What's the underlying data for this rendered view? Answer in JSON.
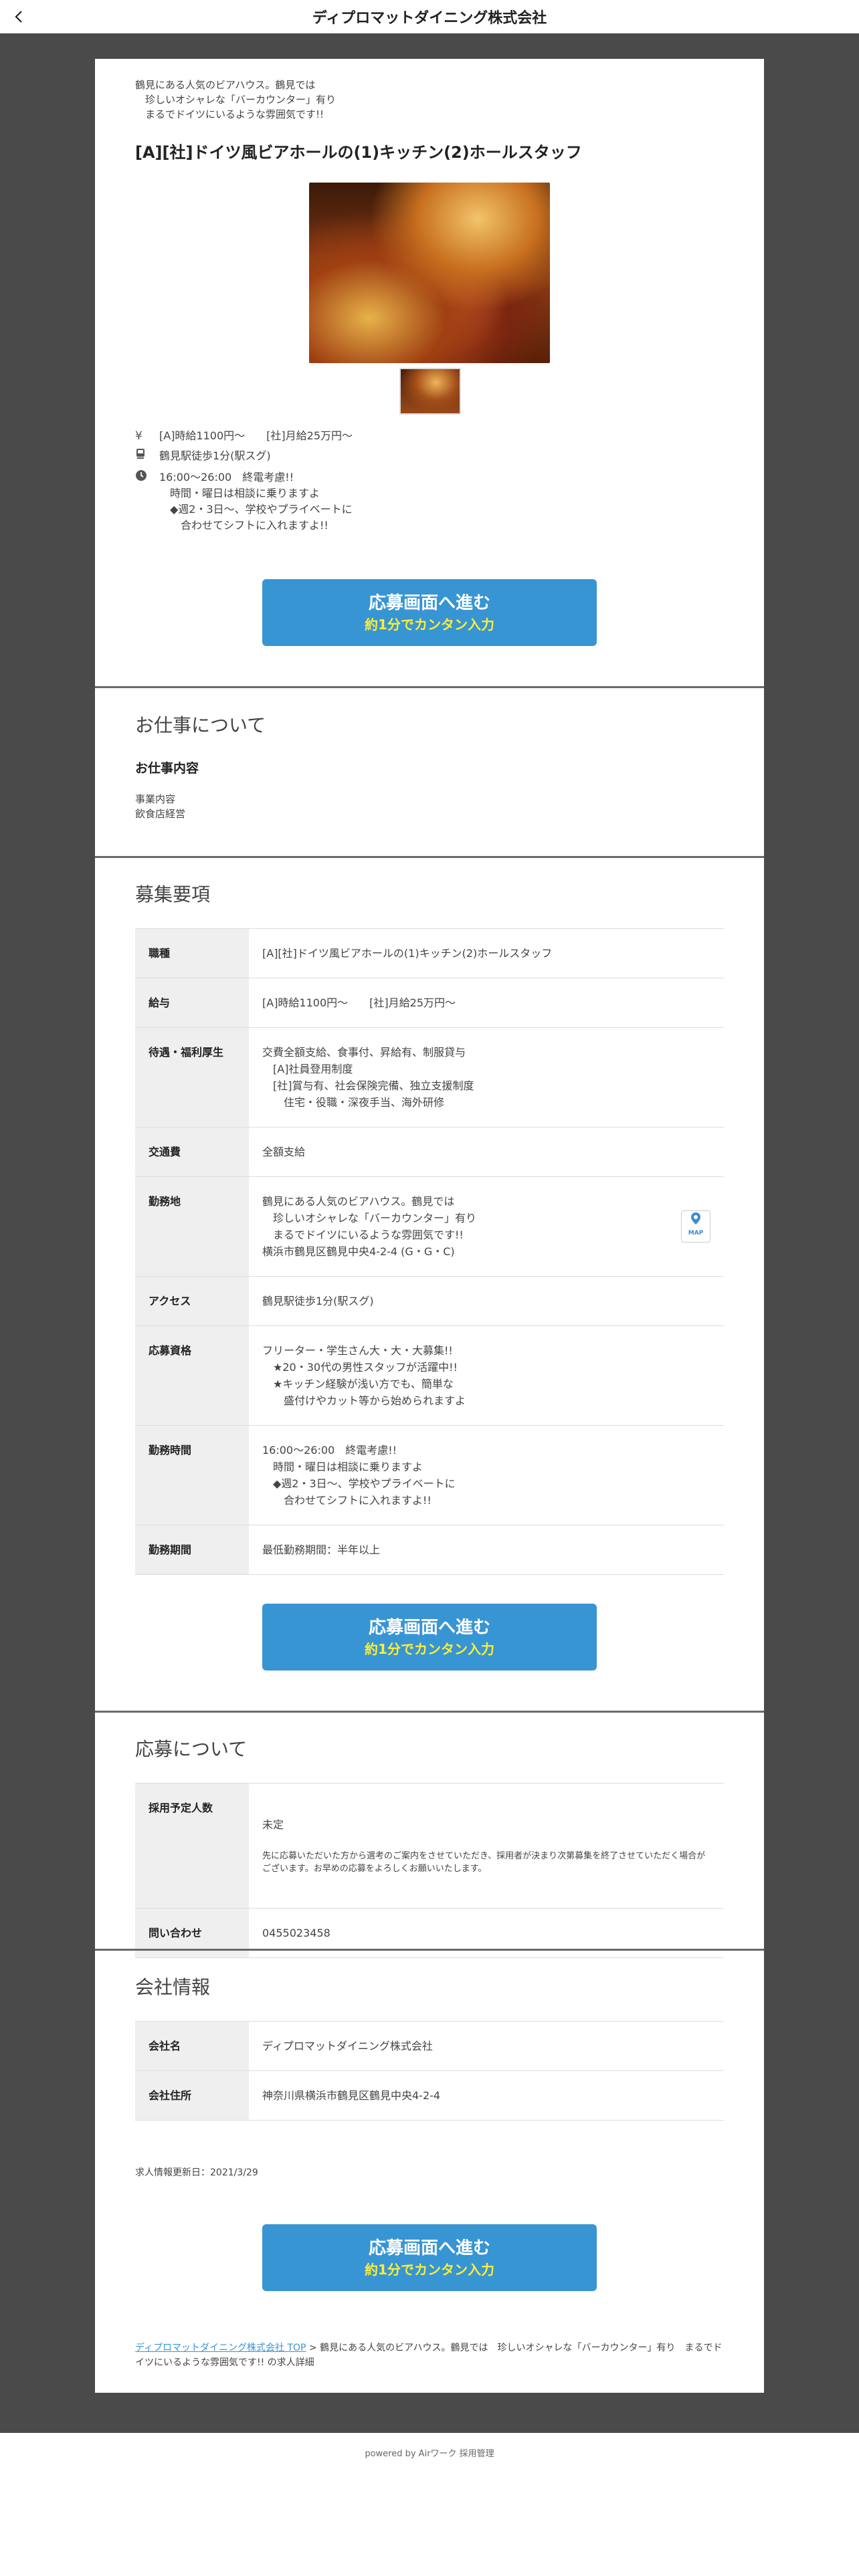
{
  "header": {
    "title": "ディプロマットダイニング株式会社",
    "back_icon": "chevron-left-icon"
  },
  "intro": "鶴見にある人気のビアハウス。鶴見では\n　珍しいオシャレな「バーカウンター」有り\n　まるでドイツにいるような雰囲気です!!",
  "job_title": "[A][社]ドイツ風ビアホールの(1)キッチン(2)ホールスタッフ",
  "features": {
    "salary": "[A]時給1100円～　　[社]月給25万円～",
    "access": "鶴見駅徒歩1分(駅スグ)",
    "hours": "16:00～26:00　終電考慮!!\n　時間・曜日は相談に乗りますよ\n　◆週2・3日～、学校やプライベートに\n　　合わせてシフトに入れますよ!!"
  },
  "apply_button": {
    "line1": "応募画面へ進む",
    "line2": "約1分でカンタン入力"
  },
  "work_section": {
    "heading": "お仕事について",
    "sub_heading": "お仕事内容",
    "content": "事業内容\n飲食店経営"
  },
  "recruit_section": {
    "heading": "募集要項",
    "rows": [
      {
        "key": "職種",
        "value": "[A][社]ドイツ風ビアホールの(1)キッチン(2)ホールスタッフ"
      },
      {
        "key": "給与",
        "value": "[A]時給1100円～　　[社]月給25万円～"
      },
      {
        "key": "待遇・福利厚生",
        "value": "交費全額支給、食事付、昇給有、制服貸与\n　[A]社員登用制度\n　[社]賞与有、社会保険完備、独立支援制度\n　　住宅・役職・深夜手当、海外研修"
      },
      {
        "key": "交通費",
        "value": "全額支給"
      },
      {
        "key": "勤務地",
        "value": "鶴見にある人気のビアハウス。鶴見では\n　珍しいオシャレな「バーカウンター」有り\n　まるでドイツにいるような雰囲気です!!\n横浜市鶴見区鶴見中央4-2-4 (G・G・C)"
      },
      {
        "key": "アクセス",
        "value": "鶴見駅徒歩1分(駅スグ)"
      },
      {
        "key": "応募資格",
        "value": "フリーター・学生さん大・大・大募集!!\n　★20・30代の男性スタッフが活躍中!!\n　★キッチン経験が浅い方でも、簡単な\n　　盛付けやカット等から始められますよ"
      },
      {
        "key": "勤務時間",
        "value": "16:00～26:00　終電考慮!!\n　時間・曜日は相談に乗りますよ\n　◆週2・3日～、学校やプライベートに\n　　合わせてシフトに入れますよ!!"
      },
      {
        "key": "勤務期間",
        "value": "最低勤務期間：半年以上"
      }
    ],
    "map_label": "MAP"
  },
  "apply_section": {
    "heading": "応募について",
    "rows": [
      {
        "key": "採用予定人数",
        "value": "未定",
        "note": "先に応募いただいた方から選考のご案内をさせていただき、採用者が決まり次第募集を終了させていただく場合がございます。お早めの応募をよろしくお願いいたします。"
      },
      {
        "key": "問い合わせ",
        "value": "0455023458"
      }
    ]
  },
  "company_section": {
    "heading": "会社情報",
    "rows": [
      {
        "key": "会社名",
        "value": "ディプロマットダイニング株式会社"
      },
      {
        "key": "会社住所",
        "value": "神奈川県横浜市鶴見区鶴見中央4-2-4"
      }
    ]
  },
  "updated": "求人情報更新日：2021/3/29",
  "breadcrumb": {
    "link": "ディプロマットダイニング株式会社 TOP",
    "rest": " > 鶴見にある人気のビアハウス。鶴見では　珍しいオシャレな「バーカウンター」有り　まるでドイツにいるような雰囲気です!! の求人詳細"
  },
  "footer": "powered by Airワーク 採用管理"
}
